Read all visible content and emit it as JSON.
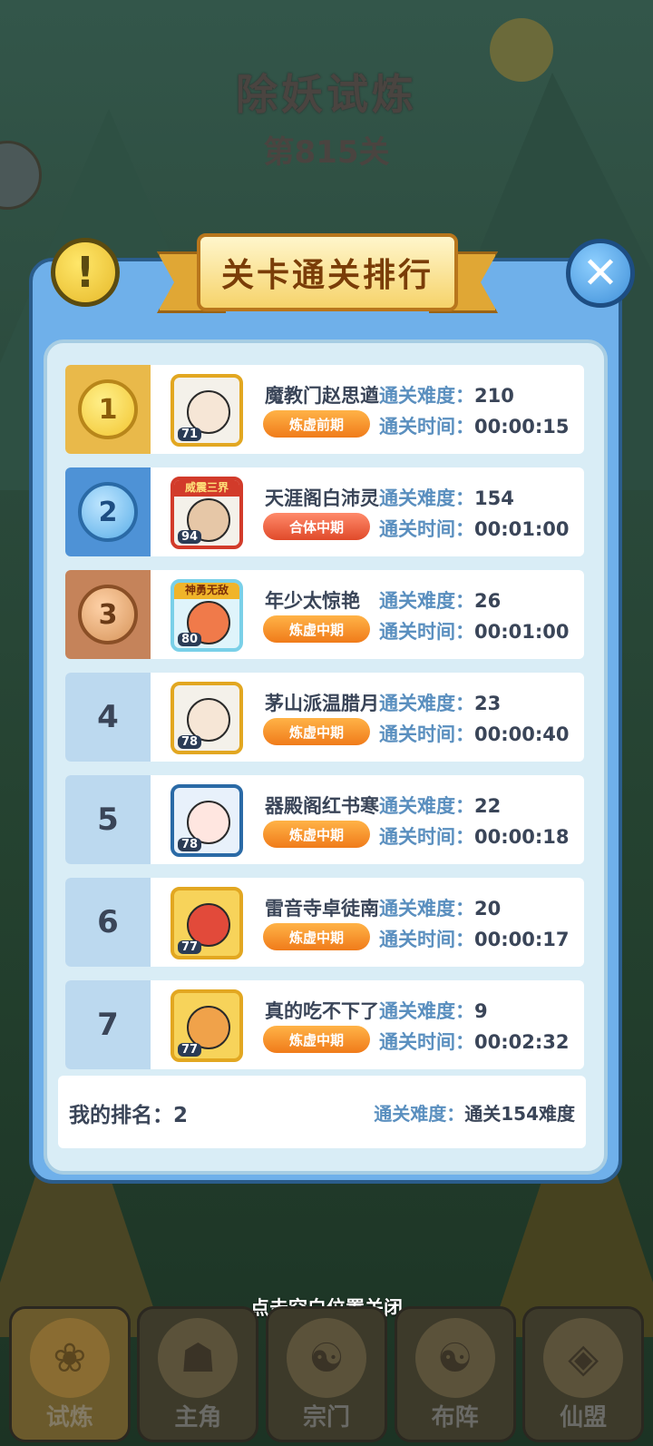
{
  "background": {
    "title": "除妖试炼",
    "subtitle": "第815关"
  },
  "modal": {
    "title": "关卡通关排行",
    "warn_icon": "!",
    "close_icon": "✕"
  },
  "labels": {
    "difficulty": "通关难度：",
    "time": "通关时间："
  },
  "rankings": [
    {
      "rank": "1",
      "name": "魔教门赵思遒",
      "realm": "炼虚前期",
      "level": "71",
      "difficulty": "210",
      "time": "00:00:15",
      "tag": ""
    },
    {
      "rank": "2",
      "name": "天涯阁白沛灵",
      "realm": "合体中期",
      "level": "94",
      "difficulty": "154",
      "time": "00:01:00",
      "tag": "威震三界"
    },
    {
      "rank": "3",
      "name": "年少太惊艳",
      "realm": "炼虚中期",
      "level": "80",
      "difficulty": "26",
      "time": "00:01:00",
      "tag": "神勇无敌"
    },
    {
      "rank": "4",
      "name": "茅山派温腊月",
      "realm": "炼虚中期",
      "level": "78",
      "difficulty": "23",
      "time": "00:00:40",
      "tag": ""
    },
    {
      "rank": "5",
      "name": "器殿阁红书寒",
      "realm": "炼虚中期",
      "level": "78",
      "difficulty": "22",
      "time": "00:00:18",
      "tag": ""
    },
    {
      "rank": "6",
      "name": "雷音寺卓徒南",
      "realm": "炼虚中期",
      "level": "77",
      "difficulty": "20",
      "time": "00:00:17",
      "tag": ""
    },
    {
      "rank": "7",
      "name": "真的吃不下了",
      "realm": "炼虚中期",
      "level": "77",
      "difficulty": "9",
      "time": "00:02:32",
      "tag": ""
    }
  ],
  "my_rank": {
    "label": "我的排名：",
    "value": "2",
    "difficulty_label": "通关难度：",
    "difficulty_value": "通关154难度"
  },
  "close_hint": "点击空白位置关闭",
  "nav": [
    {
      "label": "试炼",
      "icon": "flower-badge-icon"
    },
    {
      "label": "主角",
      "icon": "meditating-figure-icon"
    },
    {
      "label": "宗门",
      "icon": "incense-burner-icon"
    },
    {
      "label": "布阵",
      "icon": "yin-yang-icon"
    },
    {
      "label": "仙盟",
      "icon": "alliance-shield-icon"
    }
  ],
  "colors": {
    "modal_blue": "#6fb0ea",
    "panel": "#d9edf6",
    "gold_medal": "#f2c531",
    "silver_medal": "#5aaee8",
    "bronze_medal": "#d6945a",
    "realm_orange": "#f07b1a",
    "realm_red": "#e04a2a"
  }
}
